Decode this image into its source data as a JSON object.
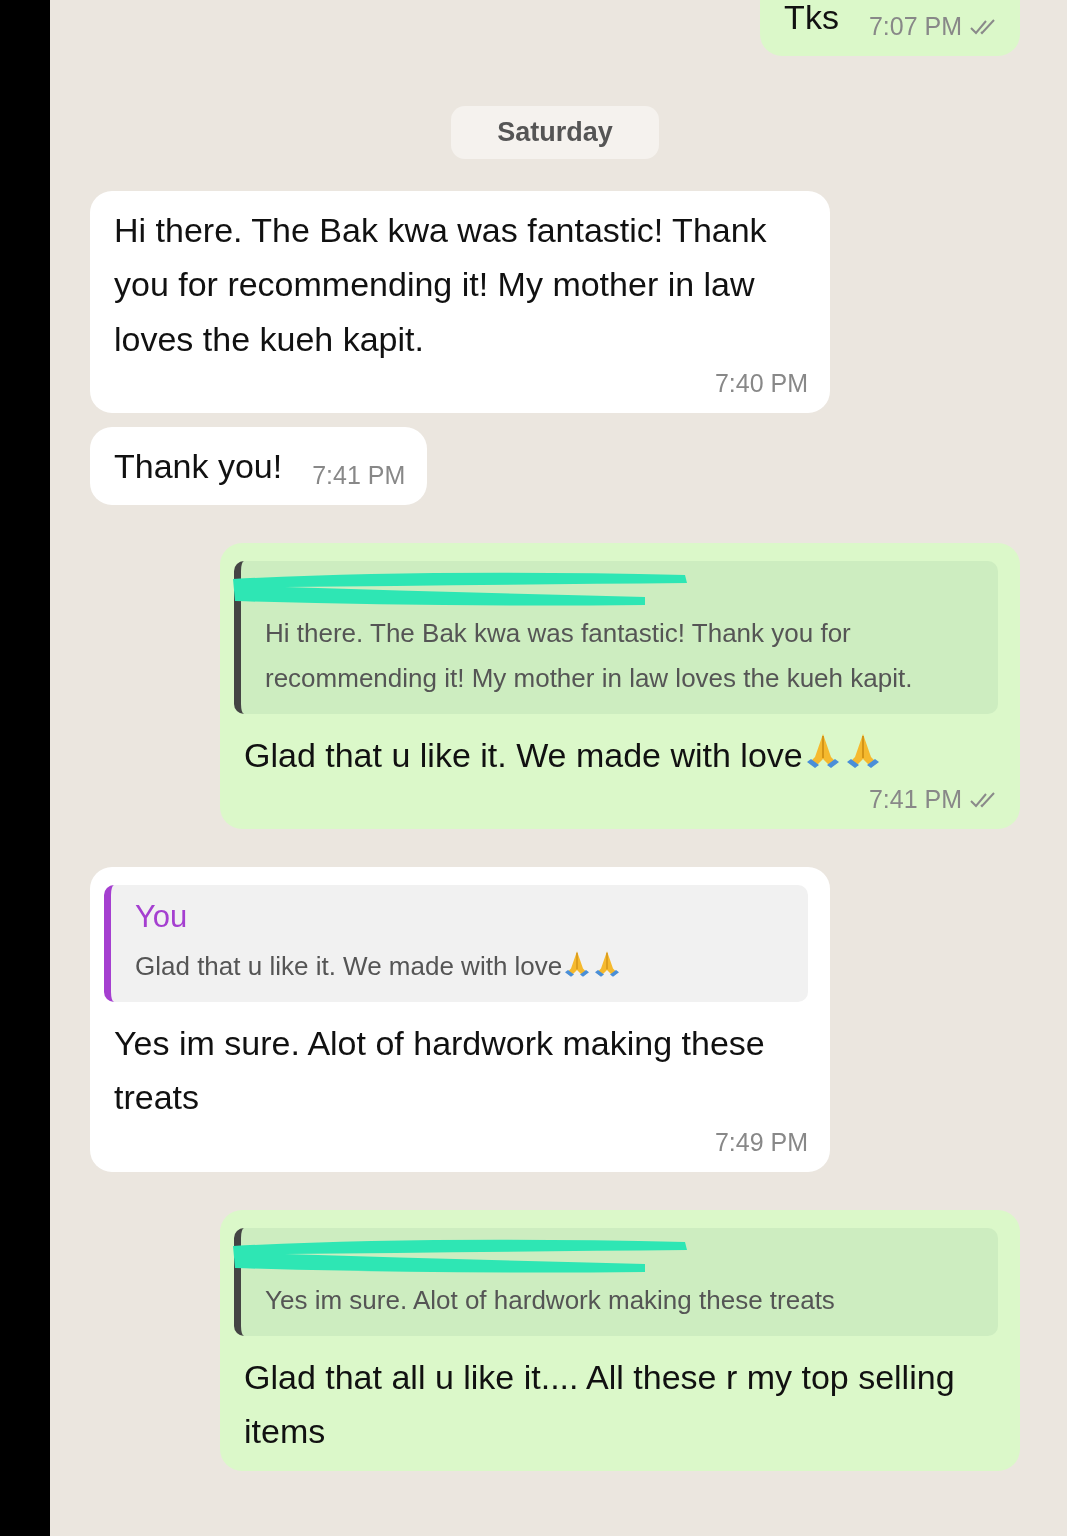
{
  "messages": [
    {
      "kind": "message",
      "outgoing": true,
      "text": "Tks",
      "time": "7:07 PM",
      "double_tick": true
    },
    {
      "kind": "date",
      "text": "Saturday"
    },
    {
      "kind": "message",
      "outgoing": false,
      "text": "Hi there. The Bak kwa was fantastic! Thank you for recommending it! My mother in law loves the kueh kapit.",
      "time": "7:40 PM"
    },
    {
      "kind": "message",
      "outgoing": false,
      "text": "Thank you!",
      "time": "7:41 PM"
    },
    {
      "kind": "message",
      "outgoing": true,
      "quote": {
        "redacted": true,
        "text": "Hi there. The Bak kwa was fantastic! Thank you for recommending it! My mother in law loves the kueh kapit."
      },
      "text": "Glad that u like it.  We made with love",
      "icons": [
        {
          "kind": "pray"
        },
        {
          "kind": "pray"
        }
      ],
      "time": "7:41 PM",
      "double_tick": true
    },
    {
      "kind": "message",
      "outgoing": false,
      "quote": {
        "author": "You",
        "text": "Glad that u like it.  We made with love",
        "icons": [
          {
            "kind": "pray"
          },
          {
            "kind": "pray"
          }
        ]
      },
      "text": "Yes im sure. Alot of hardwork making these treats",
      "time": "7:49 PM"
    },
    {
      "kind": "message",
      "outgoing": true,
      "quote": {
        "redacted": true,
        "text": "Yes im sure. Alot of hardwork making these treats"
      },
      "text": "Glad that all u like it.... All these r my top selling items"
    }
  ]
}
